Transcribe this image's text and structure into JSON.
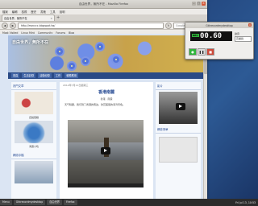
{
  "window": {
    "title": "自由世界，無所不在 - Mozilla Firefox",
    "min": "–",
    "max": "□",
    "close": "×"
  },
  "menu": [
    "檔案",
    "編輯",
    "檢視",
    "歷史",
    "書籤",
    "工具",
    "說明"
  ],
  "tab": {
    "label": "自由世界，無所不在",
    "close": "×",
    "new": "+"
  },
  "nav": {
    "back": "◀",
    "forward": "▶",
    "reload": "↻",
    "url": "http://mzcccc.blogspot.tw/",
    "search_placeholder": "Google"
  },
  "bookmarks": [
    "Most Visited",
    "Linux Mint",
    "Community",
    "Forums",
    "Blog"
  ],
  "blog": {
    "title": "自由世界，無所不在",
    "nav_items": [
      "首頁",
      "生活記錄",
      "活動紀錄",
      "工作",
      "軟體應用"
    ],
    "left_section": "熱門文章",
    "left_cap1": "自製蛋糕",
    "left_cap2": "海邊小吃",
    "left_section2": "網誌存檔",
    "post_date": "2012年7月11日星期三",
    "post_title": "香港南麓",
    "post_sub": "香港 · 南麓",
    "post_text": "天气晴朗，我们到了香港的南边，欣赏美丽的海湾景色。",
    "right_section": "影片",
    "right_section2": "網誌清單"
  },
  "recorder": {
    "title": "Gtkrecordmydesktop",
    "close": "×",
    "rec_label": "REC",
    "time": "00.60",
    "opt_label": "錄音",
    "select": "高畫質"
  },
  "taskbar": {
    "menu": "Menu",
    "items": [
      "Gtkrecordmydesktop",
      "自由世界",
      "Firefox"
    ],
    "clock": "Fri Jul 13, 10:53"
  }
}
